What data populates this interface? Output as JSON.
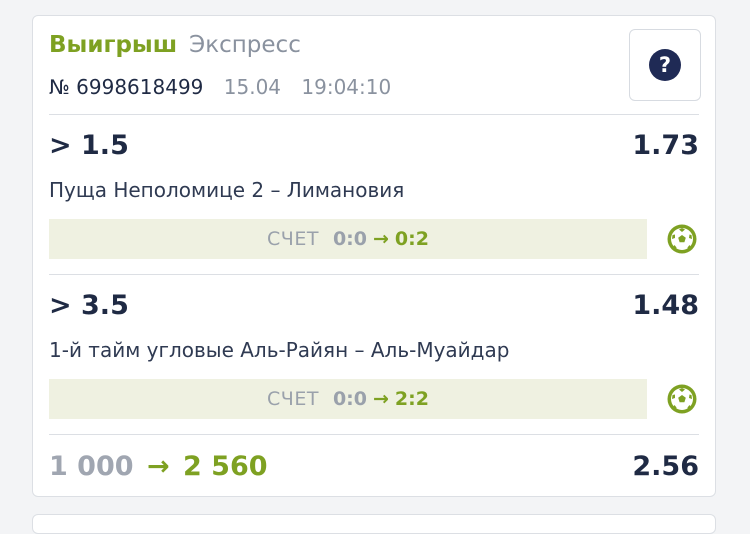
{
  "header": {
    "status": "Выигрыш",
    "type": "Экспресс",
    "ticket_number": "№ 6998618499",
    "date": "15.04",
    "time": "19:04:10",
    "help_symbol": "?",
    "help_icon": "question-circle-icon"
  },
  "bets": [
    {
      "outcome": "> 1.5",
      "odds": "1.73",
      "event": "Пуща Неполомице 2 – Лимановия",
      "score_label": "СЧЕТ",
      "score_from": "0:0",
      "score_arrow": "→",
      "score_to": "0:2",
      "sport_icon": "football-icon"
    },
    {
      "outcome": "> 3.5",
      "odds": "1.48",
      "event": "1-й тайм угловые Аль-Райян – Аль-Муайдар",
      "score_label": "СЧЕТ",
      "score_from": "0:0",
      "score_arrow": "→",
      "score_to": "2:2",
      "sport_icon": "football-icon"
    }
  ],
  "footer": {
    "stake": "1 000",
    "arrow": "→",
    "win_amount": "2 560",
    "total_odds": "2.56"
  },
  "colors": {
    "accent_green": "#7ea122",
    "dark_text": "#1f2a44",
    "muted_text": "#8a929f",
    "score_bg": "#eff1e1"
  }
}
